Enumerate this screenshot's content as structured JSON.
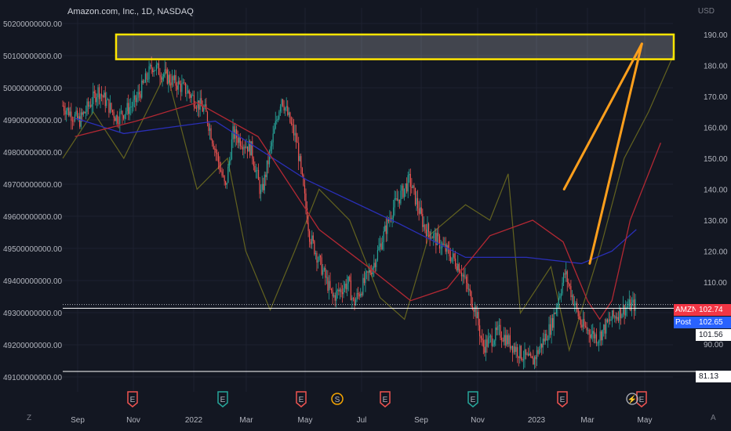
{
  "header": {
    "title": "Amazon.com, Inc., 1D, NASDAQ"
  },
  "axes": {
    "right_unit": "USD",
    "left_ticks": [
      "50200000000.00",
      "50100000000.00",
      "50000000000.00",
      "49900000000.00",
      "49800000000.00",
      "49700000000.00",
      "49600000000.00",
      "49500000000.00",
      "49400000000.00",
      "49300000000.00",
      "49200000000.00",
      "49100000000.00"
    ],
    "right_ticks": [
      "190.00",
      "180.00",
      "170.00",
      "160.00",
      "150.00",
      "140.00",
      "130.00",
      "120.00",
      "110.00",
      "90.00"
    ],
    "x_ticks": [
      "Sep",
      "Nov",
      "2022",
      "Mar",
      "May",
      "Jul",
      "Sep",
      "Nov",
      "2023",
      "Mar",
      "May"
    ]
  },
  "tags": {
    "symbol": "AMZN",
    "last": "102.74",
    "post_label": "Post",
    "post": "102.65",
    "line_a": "101.56",
    "line_b": "81.13"
  },
  "events": [
    "E",
    "E",
    "E",
    "S",
    "E",
    "E",
    "E",
    "E"
  ],
  "corners": {
    "left": "Z",
    "right": "A"
  },
  "colors": {
    "background": "#131722",
    "up": "#26a69a",
    "down": "#ef5350",
    "ma_short": "#b22833",
    "ma_long": "#2a2fb8",
    "overlay": "#6b6a1f",
    "zone": "#ffe600",
    "trend": "#ff9f1c",
    "post": "#2962ff"
  },
  "chart_data": {
    "type": "candlestick",
    "title": "Amazon.com, Inc., 1D, NASDAQ",
    "price_axis": "USD",
    "y_right_range": [
      80,
      195
    ],
    "y_left_range": [
      49080000000,
      50220000000
    ],
    "x_range": [
      "2021-08-02",
      "2023-05-31"
    ],
    "last_price": 102.74,
    "post_market": 102.65,
    "horizontal_lines": [
      101.56,
      81.13
    ],
    "close_approx": [
      [
        "2021-08-02",
        167
      ],
      [
        "2021-08-20",
        162
      ],
      [
        "2021-09-10",
        172
      ],
      [
        "2021-09-30",
        163
      ],
      [
        "2021-10-20",
        168
      ],
      [
        "2021-11-08",
        180
      ],
      [
        "2021-11-25",
        176
      ],
      [
        "2021-12-15",
        172
      ],
      [
        "2022-01-05",
        165
      ],
      [
        "2022-01-27",
        140
      ],
      [
        "2022-02-04",
        158
      ],
      [
        "2022-02-24",
        153
      ],
      [
        "2022-03-07",
        138
      ],
      [
        "2022-03-29",
        170
      ],
      [
        "2022-04-15",
        155
      ],
      [
        "2022-04-29",
        125
      ],
      [
        "2022-05-24",
        105
      ],
      [
        "2022-06-10",
        110
      ],
      [
        "2022-06-16",
        103
      ],
      [
        "2022-07-08",
        116
      ],
      [
        "2022-07-29",
        134
      ],
      [
        "2022-08-16",
        143
      ],
      [
        "2022-09-01",
        128
      ],
      [
        "2022-09-20",
        122
      ],
      [
        "2022-10-10",
        115
      ],
      [
        "2022-10-28",
        100
      ],
      [
        "2022-11-04",
        89
      ],
      [
        "2022-11-22",
        94
      ],
      [
        "2022-12-15",
        87
      ],
      [
        "2022-12-28",
        84
      ],
      [
        "2023-01-18",
        96
      ],
      [
        "2023-02-02",
        113
      ],
      [
        "2023-02-20",
        96
      ],
      [
        "2023-03-10",
        92
      ],
      [
        "2023-03-24",
        98
      ],
      [
        "2023-04-10",
        102
      ],
      [
        "2023-04-21",
        102.74
      ]
    ],
    "series": [
      {
        "values": [
          [
            0.02,
            163
          ],
          [
            0.1,
            158
          ],
          [
            0.25,
            162
          ],
          [
            0.4,
            143
          ],
          [
            0.55,
            129
          ],
          [
            0.66,
            118
          ],
          [
            0.76,
            118
          ],
          [
            0.85,
            116
          ],
          [
            0.9,
            120
          ],
          [
            0.94,
            127
          ]
        ]
      },
      {
        "values": [
          [
            0.02,
            157
          ],
          [
            0.12,
            162
          ],
          [
            0.22,
            168
          ],
          [
            0.32,
            157
          ],
          [
            0.42,
            127
          ],
          [
            0.5,
            115
          ],
          [
            0.57,
            104
          ],
          [
            0.63,
            108
          ],
          [
            0.7,
            125
          ],
          [
            0.77,
            130
          ],
          [
            0.82,
            123
          ],
          [
            0.86,
            104
          ],
          [
            0.88,
            98
          ],
          [
            0.9,
            104
          ],
          [
            0.93,
            130
          ],
          [
            0.98,
            155
          ]
        ]
      },
      {
        "values": [
          [
            0.0,
            150
          ],
          [
            0.05,
            165
          ],
          [
            0.1,
            150
          ],
          [
            0.17,
            178
          ],
          [
            0.22,
            140
          ],
          [
            0.27,
            150
          ],
          [
            0.3,
            120
          ],
          [
            0.34,
            101
          ],
          [
            0.38,
            120
          ],
          [
            0.42,
            140
          ],
          [
            0.47,
            130
          ],
          [
            0.52,
            105
          ],
          [
            0.56,
            98
          ],
          [
            0.6,
            125
          ],
          [
            0.66,
            135
          ],
          [
            0.7,
            130
          ],
          [
            0.73,
            145
          ],
          [
            0.75,
            100
          ],
          [
            0.8,
            115
          ],
          [
            0.83,
            88
          ],
          [
            0.88,
            120
          ],
          [
            0.92,
            150
          ],
          [
            0.96,
            165
          ],
          [
            1.0,
            183
          ]
        ]
      }
    ],
    "annotations": {
      "zone_price_range": [
        182,
        190
      ],
      "trendlines": [
        {
          "from": [
            "2023-02-01",
            140
          ],
          "to": [
            "2023-04-27",
            187
          ]
        },
        {
          "from": [
            "2023-03-01",
            116
          ],
          "to": [
            "2023-04-27",
            187
          ]
        }
      ]
    }
  }
}
